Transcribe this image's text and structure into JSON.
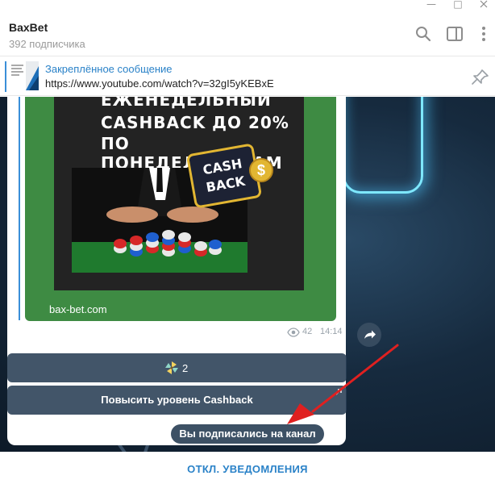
{
  "window": {
    "minimize": "—",
    "maximize": "□"
  },
  "header": {
    "title": "BaxBet",
    "subtitle": "392 подписчика",
    "icons": [
      "search-icon",
      "sidebar-icon",
      "more-icon"
    ]
  },
  "pinned": {
    "title": "Закреплённое сообщение",
    "text": "https://www.youtube.com/watch?v=32gI5yKEBxE"
  },
  "post": {
    "promo_lines": [
      "ЕЖЕНЕДЕЛЬНЫЙ",
      "CASHBACK ДО 20%",
      "ПО ПОНЕДЕЛЬНИКАМ"
    ],
    "tag_top": "CASH",
    "tag_bottom": "BACK",
    "coin": "$",
    "site": "bax-bet.com",
    "views": "42",
    "time": "14:14"
  },
  "reaction": {
    "count": "2"
  },
  "action_button": "Повысить уровень Cashback",
  "service_message": "Вы подписались на канал",
  "footer": {
    "mute_label": "ОТКЛ. УВЕДОМЛЕНИЯ"
  },
  "colors": {
    "accent": "#2a82c8",
    "promo_green": "#3e8b43",
    "gold": "#e2b632",
    "arrow_red": "#e02020"
  }
}
